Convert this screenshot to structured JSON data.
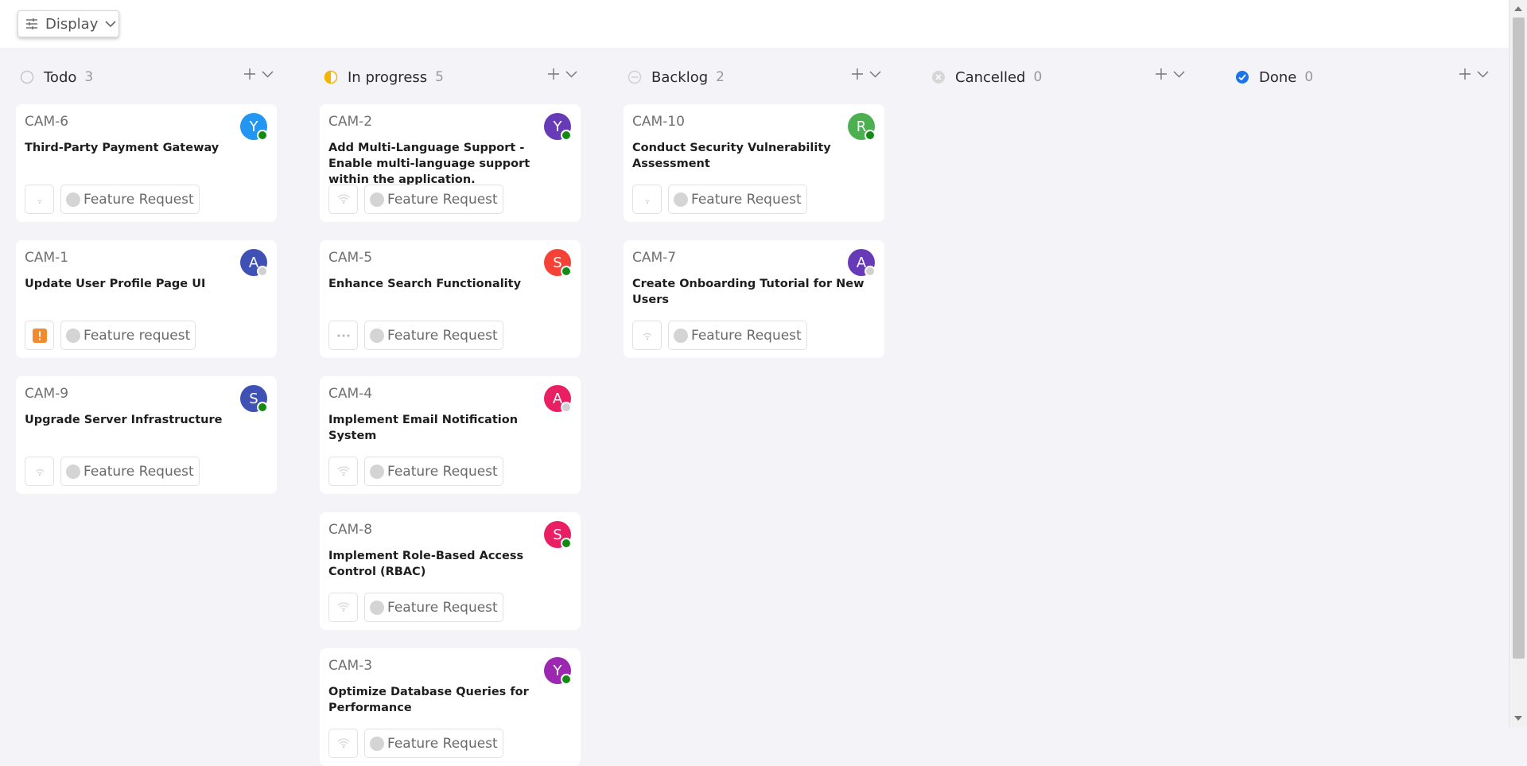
{
  "toolbar": {
    "display_label": "Display"
  },
  "colors": {
    "done_icon": "#1a73e8",
    "inprogress_icon": "#f4b400",
    "online": "#148a14",
    "offline": "#d0d0d0",
    "urgent": "#f28b2e"
  },
  "columns": [
    {
      "name": "Todo",
      "count": "3",
      "status_icon": "todo-circle-icon",
      "cards": [
        {
          "id": "CAM-6",
          "title": "Third-Party Payment Gateway",
          "avatar": "Y",
          "avatar_color": "#2196f3",
          "online": true,
          "priority_icon": "low-priority-icon",
          "label": "Feature Request"
        },
        {
          "id": "CAM-1",
          "title": "Update User Profile Page UI",
          "avatar": "A",
          "avatar_color": "#3f51b5",
          "online": false,
          "priority_icon": "urgent-priority-icon",
          "label": "Feature request"
        },
        {
          "id": "CAM-9",
          "title": "Upgrade Server Infrastructure",
          "avatar": "S",
          "avatar_color": "#3f51b5",
          "online": true,
          "priority_icon": "medium-priority-icon",
          "label": "Feature Request"
        }
      ]
    },
    {
      "name": "In progress",
      "count": "5",
      "status_icon": "half-circle-icon",
      "cards": [
        {
          "id": "CAM-2",
          "title": "Add Multi-Language Support - Enable multi-language support within the application.",
          "avatar": "Y",
          "avatar_color": "#673ab7",
          "online": true,
          "priority_icon": "high-priority-icon",
          "label": "Feature Request"
        },
        {
          "id": "CAM-5",
          "title": "Enhance Search Functionality",
          "avatar": "S",
          "avatar_color": "#f44336",
          "online": true,
          "priority_icon": "no-priority-icon",
          "label": "Feature Request"
        },
        {
          "id": "CAM-4",
          "title": "Implement Email Notification System",
          "avatar": "A",
          "avatar_color": "#e91e63",
          "online": false,
          "priority_icon": "high-priority-icon",
          "label": "Feature Request"
        },
        {
          "id": "CAM-8",
          "title": "Implement Role-Based Access Control (RBAC)",
          "avatar": "S",
          "avatar_color": "#e91e63",
          "online": true,
          "priority_icon": "high-priority-icon",
          "label": "Feature Request"
        },
        {
          "id": "CAM-3",
          "title": "Optimize Database Queries for Performance",
          "avatar": "Y",
          "avatar_color": "#9c27b0",
          "online": true,
          "priority_icon": "high-priority-icon",
          "label": "Feature Request"
        }
      ]
    },
    {
      "name": "Backlog",
      "count": "2",
      "status_icon": "backlog-circle-icon",
      "cards": [
        {
          "id": "CAM-10",
          "title": "Conduct Security Vulnerability Assessment",
          "avatar": "R",
          "avatar_color": "#4caf50",
          "online": true,
          "priority_icon": "low-priority-icon",
          "label": "Feature Request"
        },
        {
          "id": "CAM-7",
          "title": "Create Onboarding Tutorial for New Users",
          "avatar": "A",
          "avatar_color": "#673ab7",
          "online": false,
          "priority_icon": "medium-priority-icon",
          "label": "Feature Request"
        }
      ]
    },
    {
      "name": "Cancelled",
      "count": "0",
      "status_icon": "cancelled-circle-icon",
      "cards": []
    },
    {
      "name": "Done",
      "count": "0",
      "status_icon": "done-check-icon",
      "cards": []
    }
  ]
}
